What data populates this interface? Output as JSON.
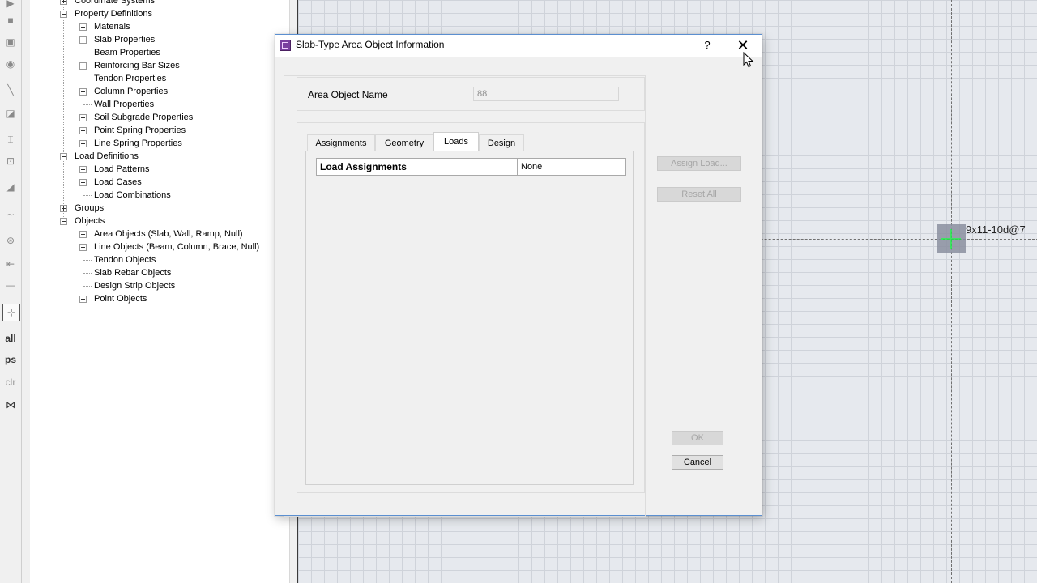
{
  "toolbar": {
    "all_label": "all",
    "ps_label": "ps",
    "clr_label": "clr"
  },
  "tree": {
    "items": [
      {
        "label": "Coordinate Systems"
      },
      {
        "label": "Property Definitions"
      },
      {
        "label": "Materials"
      },
      {
        "label": "Slab Properties"
      },
      {
        "label": "Beam Properties"
      },
      {
        "label": "Reinforcing Bar Sizes"
      },
      {
        "label": "Tendon Properties"
      },
      {
        "label": "Column Properties"
      },
      {
        "label": "Wall Properties"
      },
      {
        "label": "Soil Subgrade Properties"
      },
      {
        "label": "Point Spring Properties"
      },
      {
        "label": "Line Spring Properties"
      },
      {
        "label": "Load Definitions"
      },
      {
        "label": "Load Patterns"
      },
      {
        "label": "Load Cases"
      },
      {
        "label": "Load Combinations"
      },
      {
        "label": "Groups"
      },
      {
        "label": "Objects"
      },
      {
        "label": "Area Objects (Slab, Wall, Ramp, Null)"
      },
      {
        "label": "Line Objects (Beam, Column, Brace, Null)"
      },
      {
        "label": "Tendon Objects"
      },
      {
        "label": "Slab Rebar Objects"
      },
      {
        "label": "Design Strip Objects"
      },
      {
        "label": "Point Objects"
      }
    ]
  },
  "canvas": {
    "point_label": "9x11-10d@7",
    "marker_color": "#23e04a"
  },
  "dialog": {
    "title": "Slab-Type Area Object Information",
    "help_label": "?",
    "close_label": "✕",
    "area_object_name_label": "Area Object Name",
    "area_object_name_value": "88",
    "tabs": [
      {
        "label": "Assignments",
        "active": false
      },
      {
        "label": "Geometry",
        "active": false
      },
      {
        "label": "Loads",
        "active": true
      },
      {
        "label": "Design",
        "active": false
      }
    ],
    "grid": {
      "header_left": "Load Assignments",
      "header_right": "None"
    },
    "buttons": {
      "assign_load": "Assign Load...",
      "reset_all": "Reset All",
      "ok": "OK",
      "cancel": "Cancel"
    }
  }
}
